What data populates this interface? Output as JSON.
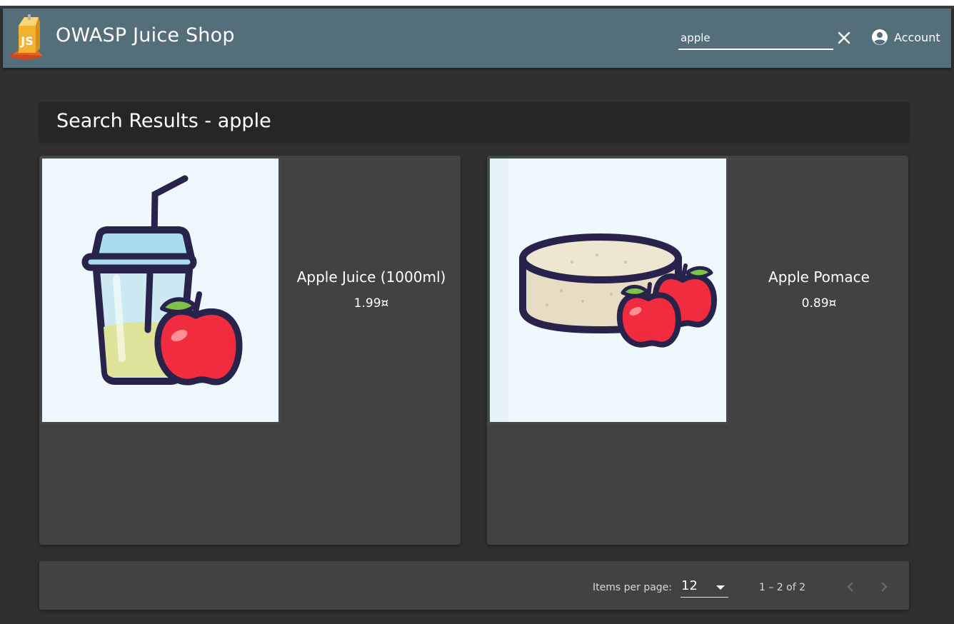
{
  "app": {
    "title": "OWASP Juice Shop"
  },
  "header": {
    "search": {
      "value": "apple",
      "placeholder": ""
    },
    "account_label": "Account"
  },
  "results": {
    "heading": "Search Results - apple",
    "products": [
      {
        "name": "Apple Juice (1000ml)",
        "price": "1.99¤"
      },
      {
        "name": "Apple Pomace",
        "price": "0.89¤"
      }
    ]
  },
  "paginator": {
    "items_per_page_label": "Items per page:",
    "items_per_page_value": "12",
    "range_label": "1 – 2 of 2"
  },
  "colors": {
    "toolbar": "#546e7a",
    "background": "#303030",
    "card": "#424242",
    "image_bg": "#eff9fd"
  },
  "icons": {
    "logo": "juice-shop-logo-icon",
    "clear": "close-icon",
    "account": "account-circle-icon",
    "dropdown": "caret-down-icon",
    "prev": "chevron-left-icon",
    "next": "chevron-right-icon"
  }
}
